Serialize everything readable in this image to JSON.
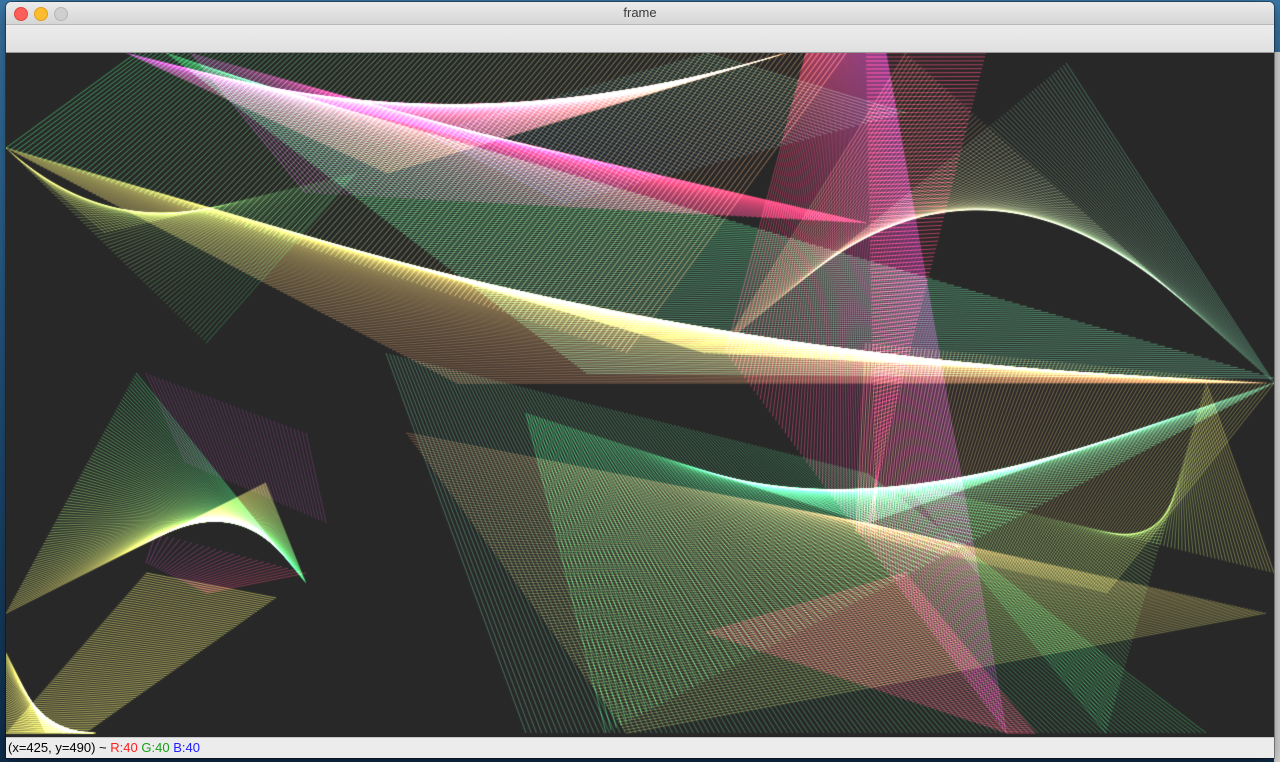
{
  "window": {
    "title": "frame"
  },
  "status": {
    "coords": "(x=425, y=490) ~",
    "r": "R:40",
    "g": "G:40",
    "b": "B:40",
    "coords_color": "#000000",
    "r_color": "#ff2020",
    "g_color": "#18a018",
    "b_color": "#2020ff"
  },
  "canvas": {
    "background_color": "#282828",
    "content": "string-art line envelopes",
    "palette": [
      "#ffff66",
      "#33ff66",
      "#ff3366",
      "#cc33cc",
      "#ff9966",
      "#3366cc",
      "#66cc99"
    ]
  }
}
